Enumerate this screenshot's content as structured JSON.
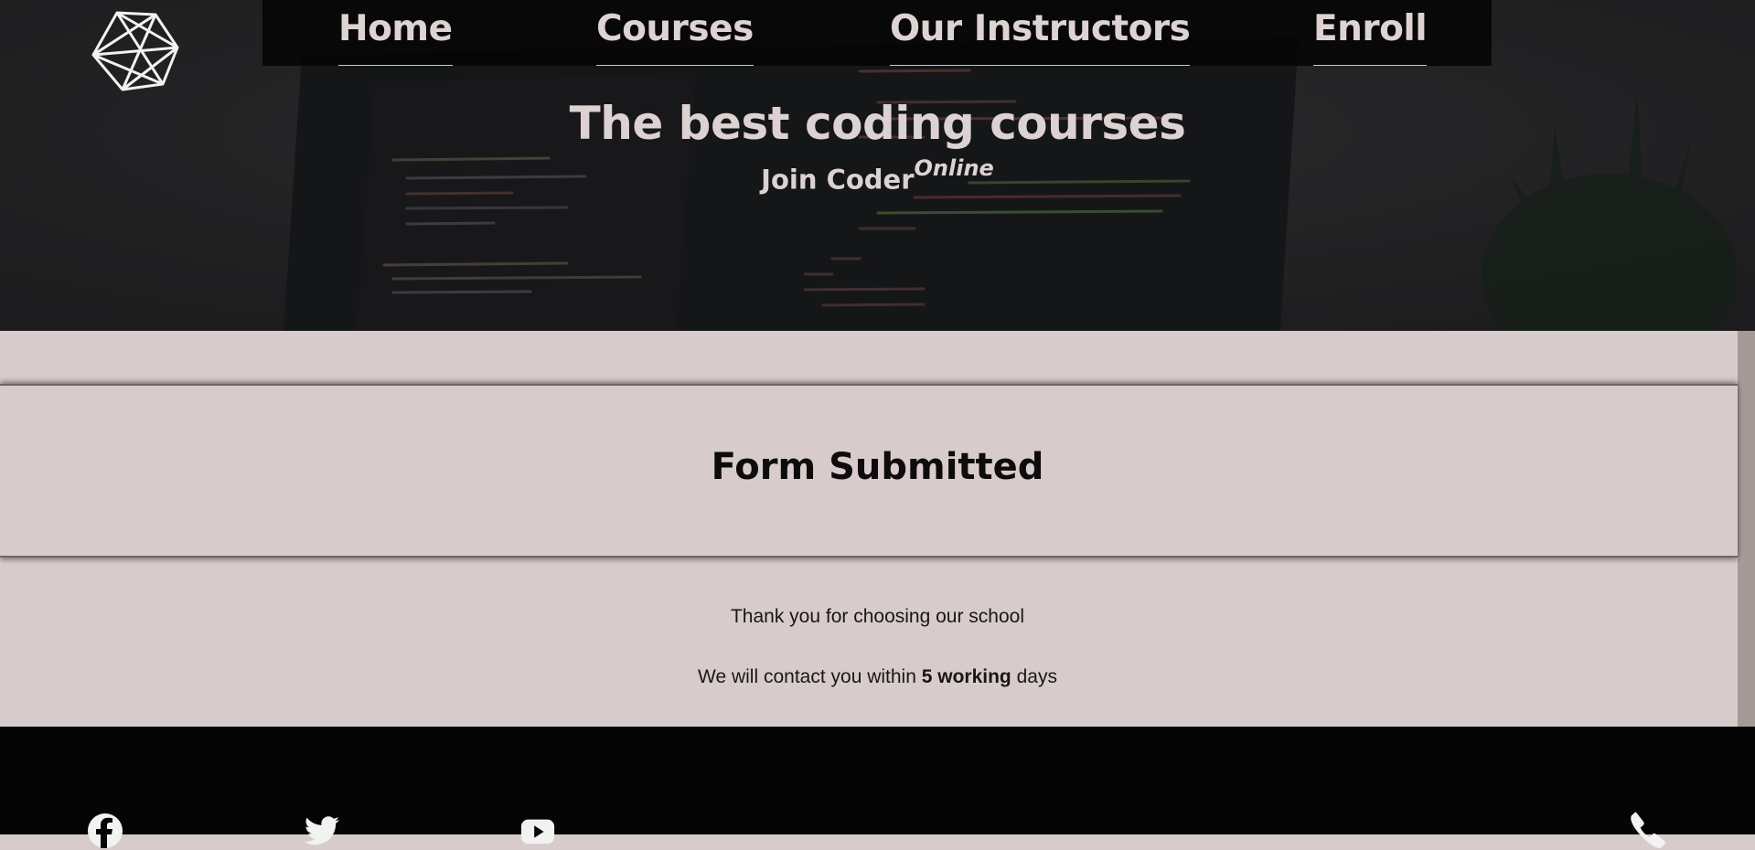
{
  "nav": {
    "items": [
      {
        "label": "Home"
      },
      {
        "label": "Courses"
      },
      {
        "label": "Our Instructors"
      },
      {
        "label": "Enroll"
      }
    ]
  },
  "hero": {
    "title": "The best coding courses",
    "subtitle_main": "Join Coder",
    "subtitle_sup": "Online"
  },
  "main": {
    "heading": "Form Submitted",
    "thanks": "Thank you for choosing our school",
    "contact_prefix": "We will contact you within",
    "contact_bold": "5 working",
    "contact_suffix": "days"
  },
  "footer": {
    "icons": [
      "facebook-icon",
      "twitter-icon",
      "youtube-icon",
      "phone-icon"
    ]
  },
  "colors": {
    "page_bg": "#d7cccb",
    "footer_bg": "#050505",
    "nav_bg": "#050505",
    "hero_text": "#dcd2d1"
  }
}
